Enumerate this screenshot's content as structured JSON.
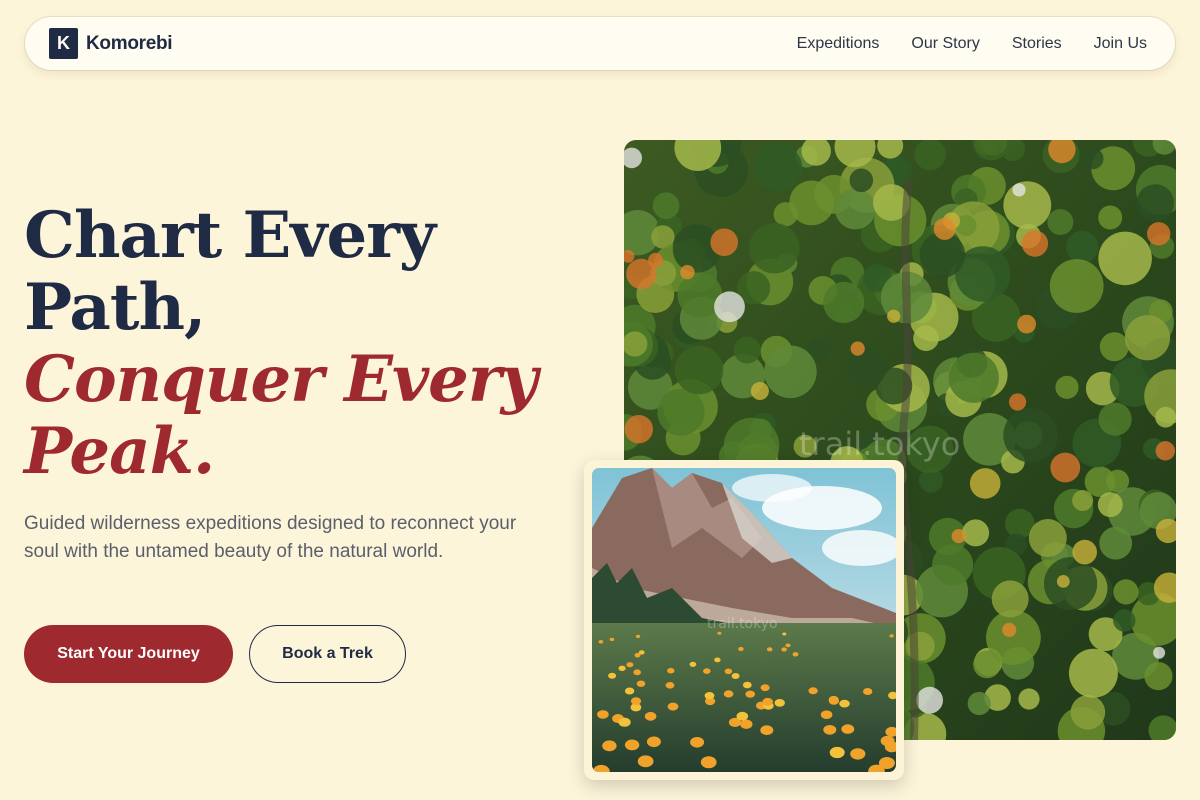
{
  "nav": {
    "logo_letter": "K",
    "brand": "Komorebi",
    "links": [
      "Expeditions",
      "Our Story",
      "Stories",
      "Join Us"
    ]
  },
  "hero": {
    "headline_line1": "Chart Every",
    "headline_line2": "Path,",
    "headline_line3": "Conquer Every",
    "headline_line4": "Peak.",
    "subtitle": "Guided wilderness expeditions designed to reconnect your soul with the untamed beauty of the natural world.",
    "primary_cta": "Start Your Journey",
    "secondary_cta": "Book a Trek"
  },
  "images": {
    "forest_watermark": "trail.tokyo",
    "meadow_watermark": "trail.tokyo"
  },
  "colors": {
    "background": "#fdf5da",
    "navy": "#1f2a44",
    "accent": "#9e2a2f"
  }
}
